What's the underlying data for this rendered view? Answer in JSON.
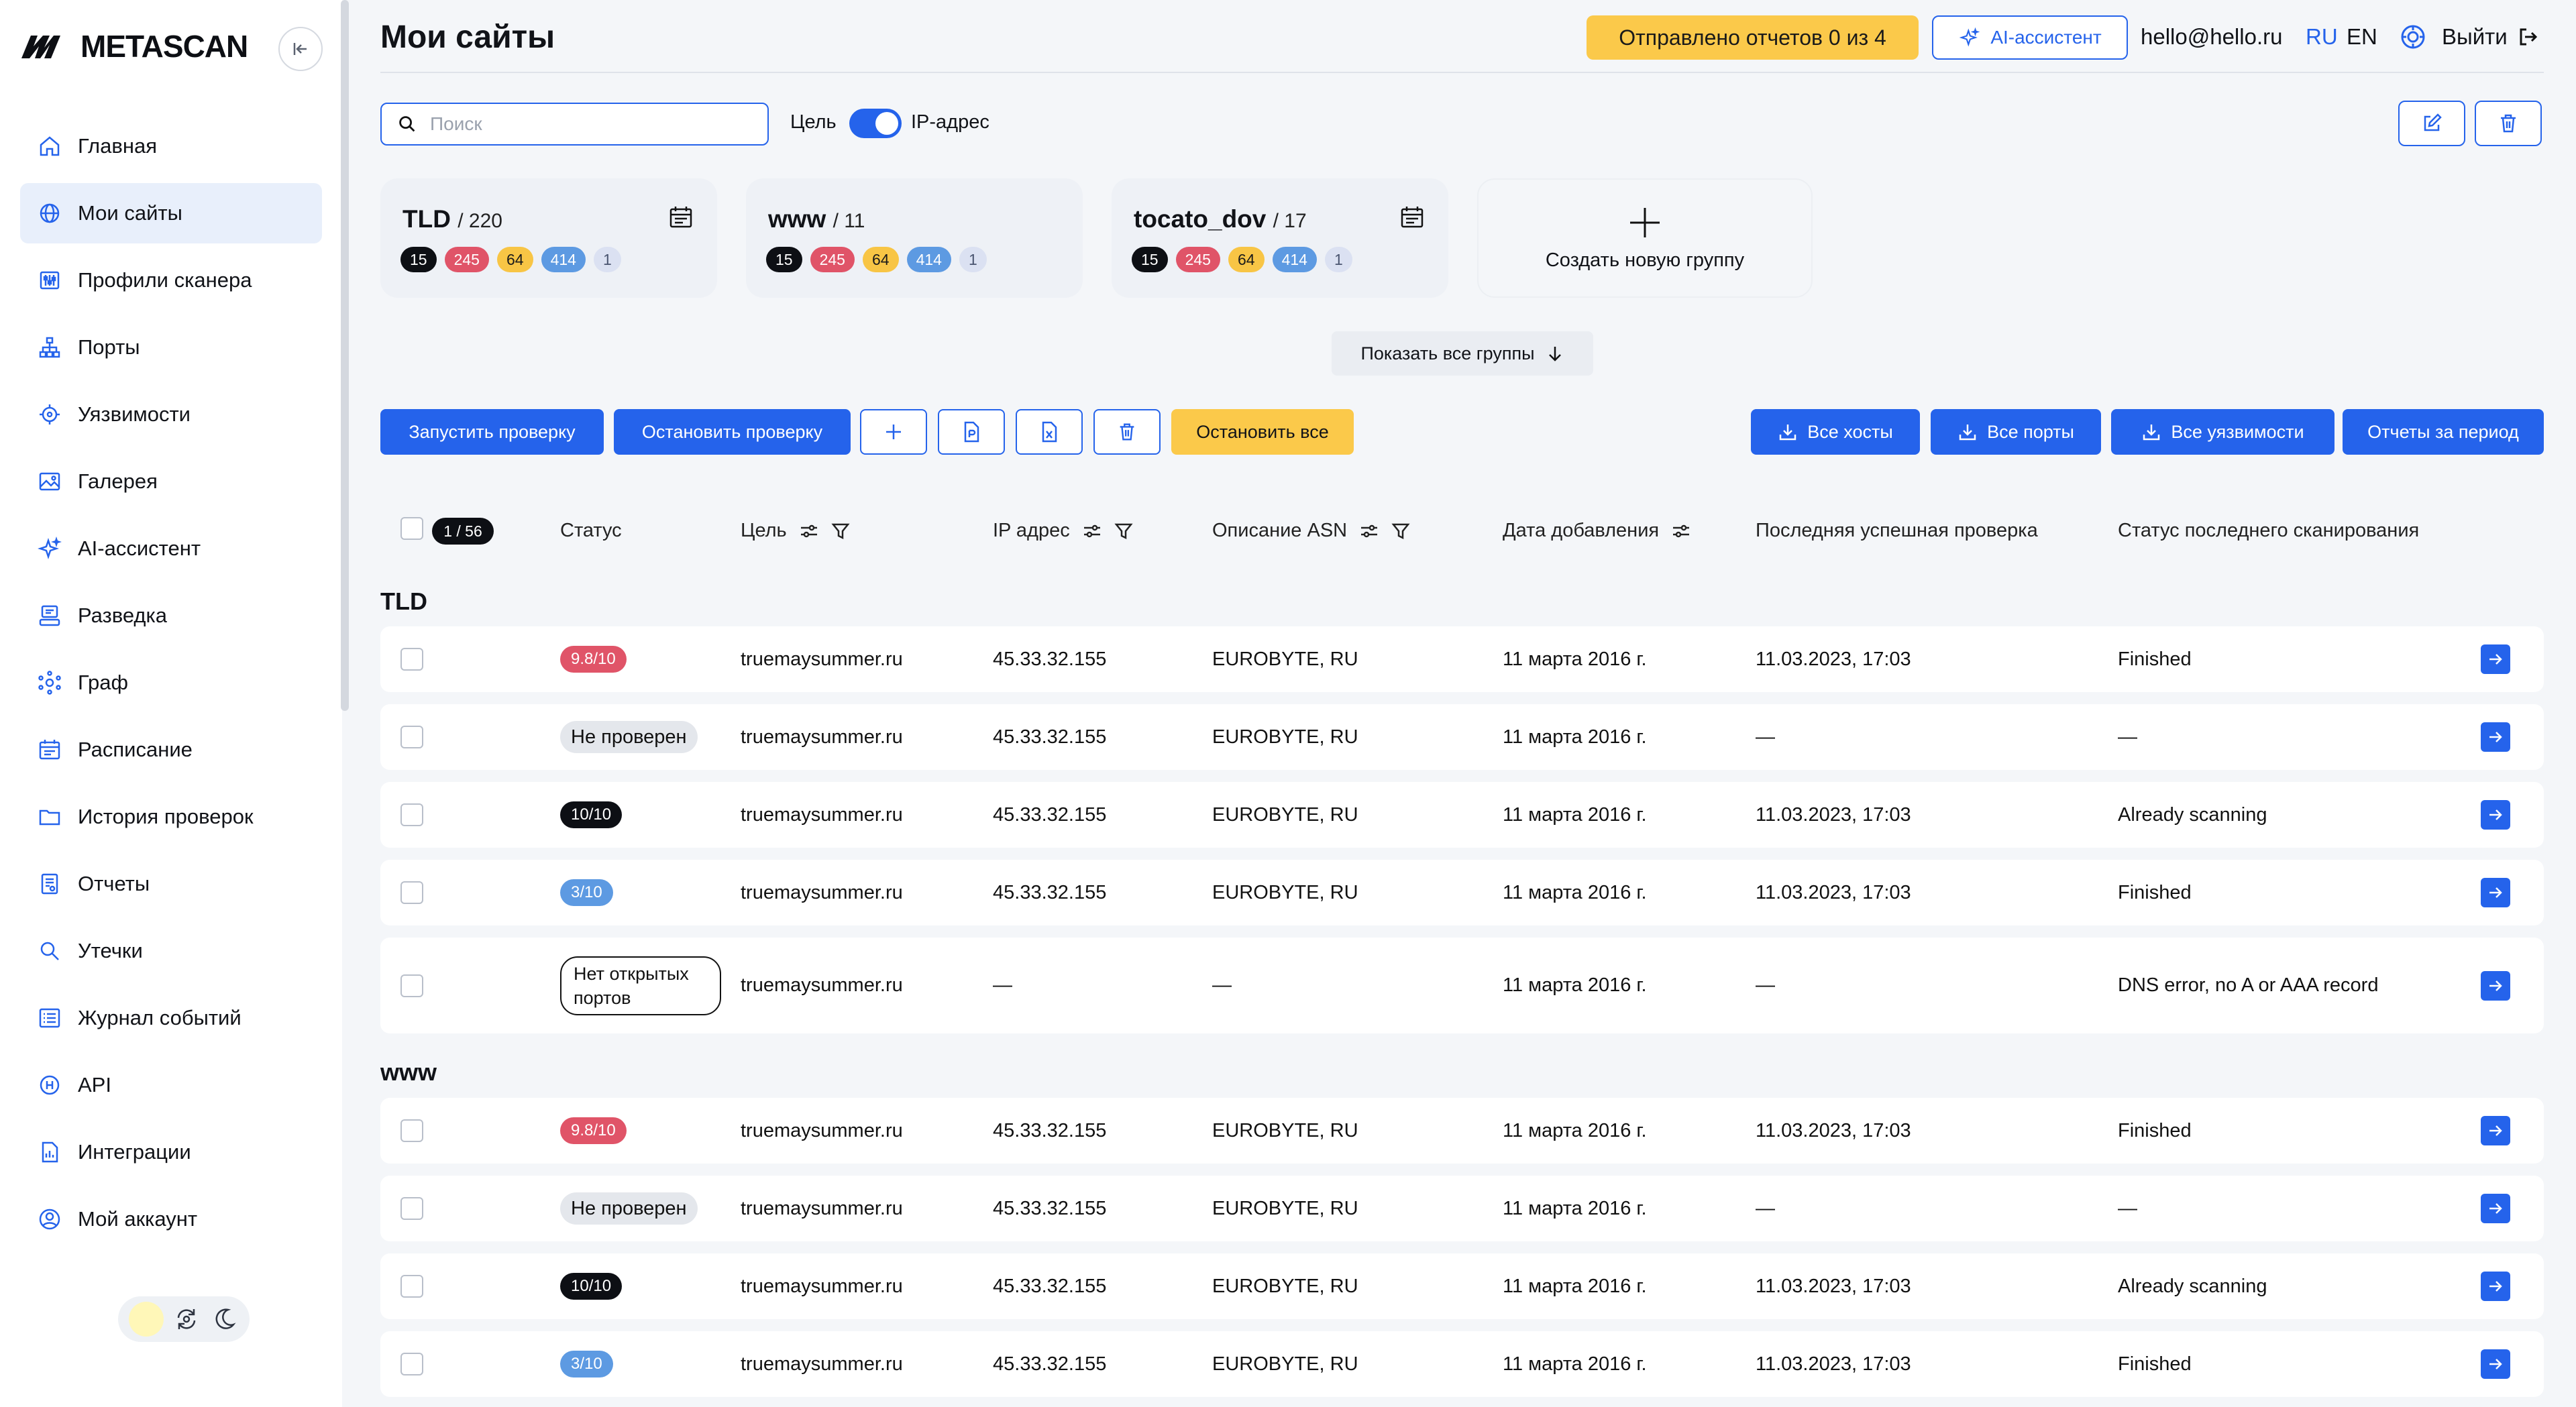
{
  "app": {
    "logo": "METASCAN"
  },
  "sidebar": {
    "items": [
      {
        "label": "Главная",
        "icon": "home-icon"
      },
      {
        "label": "Мои сайты",
        "icon": "globe-icon"
      },
      {
        "label": "Профили сканера",
        "icon": "sliders-icon"
      },
      {
        "label": "Порты",
        "icon": "network-icon"
      },
      {
        "label": "Уязвимости",
        "icon": "target-icon"
      },
      {
        "label": "Галерея",
        "icon": "image-icon"
      },
      {
        "label": "AI-ассистент",
        "icon": "sparkle-icon"
      },
      {
        "label": "Разведка",
        "icon": "recon-icon"
      },
      {
        "label": "Граф",
        "icon": "graph-icon"
      },
      {
        "label": "Расписание",
        "icon": "calendar-icon"
      },
      {
        "label": "История проверок",
        "icon": "folder-icon"
      },
      {
        "label": "Отчеты",
        "icon": "report-icon"
      },
      {
        "label": "Утечки",
        "icon": "search-icon"
      },
      {
        "label": "Журнал событий",
        "icon": "list-icon"
      },
      {
        "label": "API",
        "icon": "api-icon"
      },
      {
        "label": "Интеграции",
        "icon": "integration-icon"
      },
      {
        "label": "Мой аккаунт",
        "icon": "user-icon"
      }
    ]
  },
  "header": {
    "title": "Мои сайты",
    "reports_sent": "Отправлено отчетов 0 из 4",
    "ai_button": "AI-ассистент",
    "email": "hello@hello.ru",
    "lang_ru": "RU",
    "lang_en": "EN",
    "logout": "Выйти"
  },
  "filters": {
    "search_placeholder": "Поиск",
    "toggle_left": "Цель",
    "toggle_right": "IP-адрес",
    "toggle_on": true
  },
  "groups": [
    {
      "name": "TLD",
      "count": "/ 220",
      "pills": [
        "15",
        "245",
        "64",
        "414",
        "1"
      ]
    },
    {
      "name": "www",
      "count": "/ 11",
      "pills": [
        "15",
        "245",
        "64",
        "414",
        "1"
      ]
    },
    {
      "name": "tocato_dov",
      "count": "/ 17",
      "pills": [
        "15",
        "245",
        "64",
        "414",
        "1"
      ]
    }
  ],
  "new_group": "Создать новую группу",
  "show_all_groups": "Показать все группы",
  "toolbar": {
    "start": "Запустить проверку",
    "stop": "Остановить проверку",
    "stop_all": "Остановить все",
    "all_hosts": "Все хосты",
    "all_ports": "Все порты",
    "all_vulns": "Все уязвимости",
    "period_reports": "Отчеты за период"
  },
  "table": {
    "selected": "1 / 56",
    "columns": [
      "Статус",
      "Цель",
      "IP адрес",
      "Описание ASN",
      "Дата добавления",
      "Последняя успешная проверка",
      "Статус последнего сканирования"
    ],
    "sections": [
      {
        "title": "TLD",
        "rows": [
          {
            "status": "9.8/10",
            "target": "truemaysummer.ru",
            "ip": "45.33.32.155",
            "asn": "EUROBYTE, RU",
            "added": "11 марта 2016 г.",
            "last_ok": "11.03.2023, 17:03",
            "scan_status": "Finished"
          },
          {
            "status": "Не проверен",
            "target": "truemaysummer.ru",
            "ip": "45.33.32.155",
            "asn": "EUROBYTE, RU",
            "added": "11 марта 2016 г.",
            "last_ok": "—",
            "scan_status": "—"
          },
          {
            "status": "10/10",
            "target": "truemaysummer.ru",
            "ip": "45.33.32.155",
            "asn": "EUROBYTE, RU",
            "added": "11 марта 2016 г.",
            "last_ok": "11.03.2023, 17:03",
            "scan_status": "Already scanning"
          },
          {
            "status": "3/10",
            "target": "truemaysummer.ru",
            "ip": "45.33.32.155",
            "asn": "EUROBYTE, RU",
            "added": "11 марта 2016 г.",
            "last_ok": "11.03.2023, 17:03",
            "scan_status": "Finished"
          },
          {
            "status": "Нет открытых портов",
            "target": "truemaysummer.ru",
            "ip": "—",
            "asn": "—",
            "added": "11 марта 2016 г.",
            "last_ok": "—",
            "scan_status": "DNS error, no A or AAA record"
          }
        ]
      },
      {
        "title": "www",
        "rows": [
          {
            "status": "9.8/10",
            "target": "truemaysummer.ru",
            "ip": "45.33.32.155",
            "asn": "EUROBYTE, RU",
            "added": "11 марта 2016 г.",
            "last_ok": "11.03.2023, 17:03",
            "scan_status": "Finished"
          },
          {
            "status": "Не проверен",
            "target": "truemaysummer.ru",
            "ip": "45.33.32.155",
            "asn": "EUROBYTE, RU",
            "added": "11 марта 2016 г.",
            "last_ok": "—",
            "scan_status": "—"
          },
          {
            "status": "10/10",
            "target": "truemaysummer.ru",
            "ip": "45.33.32.155",
            "asn": "EUROBYTE, RU",
            "added": "11 марта 2016 г.",
            "last_ok": "11.03.2023, 17:03",
            "scan_status": "Already scanning"
          },
          {
            "status": "3/10",
            "target": "truemaysummer.ru",
            "ip": "45.33.32.155",
            "asn": "EUROBYTE, RU",
            "added": "11 марта 2016 г.",
            "last_ok": "11.03.2023, 17:03",
            "scan_status": "Finished"
          }
        ]
      }
    ]
  },
  "colors": {
    "accent": "#2563eb",
    "warning": "#fbc94a",
    "danger": "#e05468",
    "info": "#5d9ae2"
  }
}
